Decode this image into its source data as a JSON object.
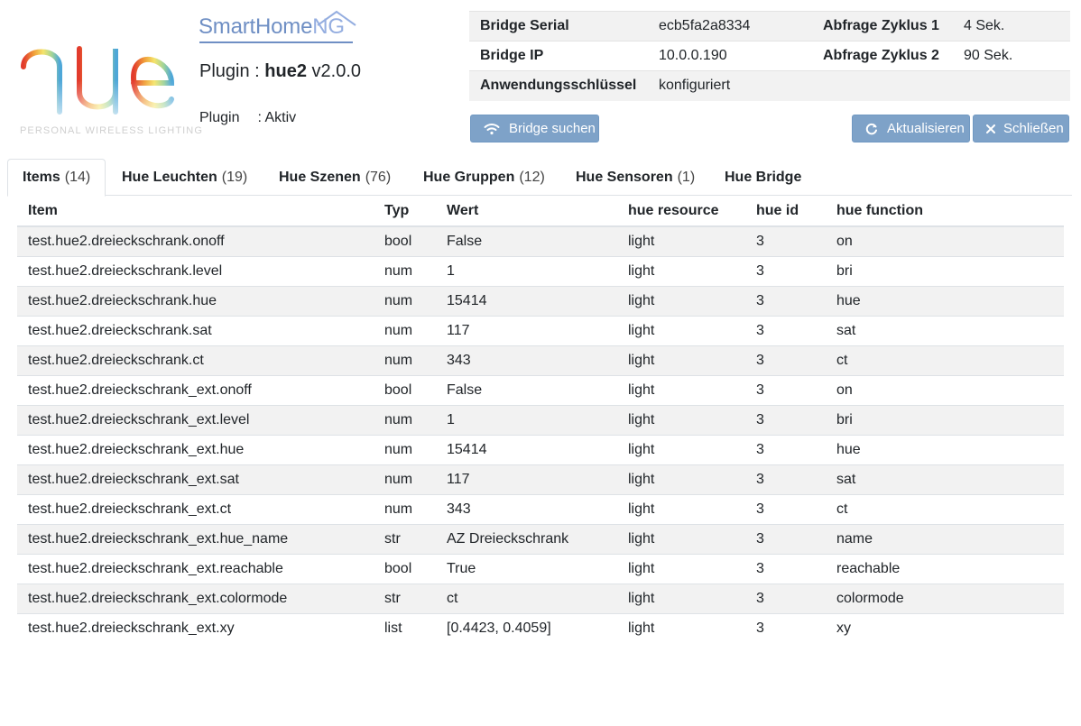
{
  "header": {
    "hue_tagline": "PERSONAL WIRELESS LIGHTING",
    "brand_main": "SmartHome",
    "brand_ng": "NG",
    "plugin_prefix": "Plugin : ",
    "plugin_name": "hue2",
    "plugin_version": " v2.0.0",
    "status_label": "Plugin",
    "status_value": ": Aktiv"
  },
  "info": {
    "rows": [
      {
        "k1": "Bridge Serial",
        "v1": "ecb5fa2a8334",
        "k2": "Abfrage Zyklus 1",
        "v2": "4 Sek."
      },
      {
        "k1": "Bridge IP",
        "v1": "10.0.0.190",
        "k2": "Abfrage Zyklus 2",
        "v2": "90 Sek."
      },
      {
        "k1": "Anwendungsschlüssel",
        "v1": "konfiguriert"
      }
    ]
  },
  "buttons": {
    "search": "Bridge suchen",
    "refresh": "Aktualisieren",
    "close": "Schließen"
  },
  "tabs": [
    {
      "label": "Items",
      "count": "(14)"
    },
    {
      "label": "Hue Leuchten",
      "count": "(19)"
    },
    {
      "label": "Hue Szenen",
      "count": "(76)"
    },
    {
      "label": "Hue Gruppen",
      "count": "(12)"
    },
    {
      "label": "Hue Sensoren",
      "count": "(1)"
    },
    {
      "label": "Hue Bridge",
      "count": ""
    }
  ],
  "table": {
    "headers": [
      "Item",
      "Typ",
      "Wert",
      "hue resource",
      "hue id",
      "hue function"
    ],
    "rows": [
      [
        "test.hue2.dreieckschrank.onoff",
        "bool",
        "False",
        "light",
        "3",
        "on"
      ],
      [
        "test.hue2.dreieckschrank.level",
        "num",
        "1",
        "light",
        "3",
        "bri"
      ],
      [
        "test.hue2.dreieckschrank.hue",
        "num",
        "15414",
        "light",
        "3",
        "hue"
      ],
      [
        "test.hue2.dreieckschrank.sat",
        "num",
        "117",
        "light",
        "3",
        "sat"
      ],
      [
        "test.hue2.dreieckschrank.ct",
        "num",
        "343",
        "light",
        "3",
        "ct"
      ],
      [
        "test.hue2.dreieckschrank_ext.onoff",
        "bool",
        "False",
        "light",
        "3",
        "on"
      ],
      [
        "test.hue2.dreieckschrank_ext.level",
        "num",
        "1",
        "light",
        "3",
        "bri"
      ],
      [
        "test.hue2.dreieckschrank_ext.hue",
        "num",
        "15414",
        "light",
        "3",
        "hue"
      ],
      [
        "test.hue2.dreieckschrank_ext.sat",
        "num",
        "117",
        "light",
        "3",
        "sat"
      ],
      [
        "test.hue2.dreieckschrank_ext.ct",
        "num",
        "343",
        "light",
        "3",
        "ct"
      ],
      [
        "test.hue2.dreieckschrank_ext.hue_name",
        "str",
        "AZ Dreieckschrank",
        "light",
        "3",
        "name"
      ],
      [
        "test.hue2.dreieckschrank_ext.reachable",
        "bool",
        "True",
        "light",
        "3",
        "reachable"
      ],
      [
        "test.hue2.dreieckschrank_ext.colormode",
        "str",
        "ct",
        "light",
        "3",
        "colormode"
      ],
      [
        "test.hue2.dreieckschrank_ext.xy",
        "list",
        "[0.4423, 0.4059]",
        "light",
        "3",
        "xy"
      ]
    ]
  },
  "icons": {
    "search": "wifi-icon",
    "refresh": "refresh-icon",
    "close": "close-icon"
  },
  "colors": {
    "button": "#7ea2c8",
    "brand": "#6f8fc4",
    "stripe": "#f2f2f2"
  }
}
